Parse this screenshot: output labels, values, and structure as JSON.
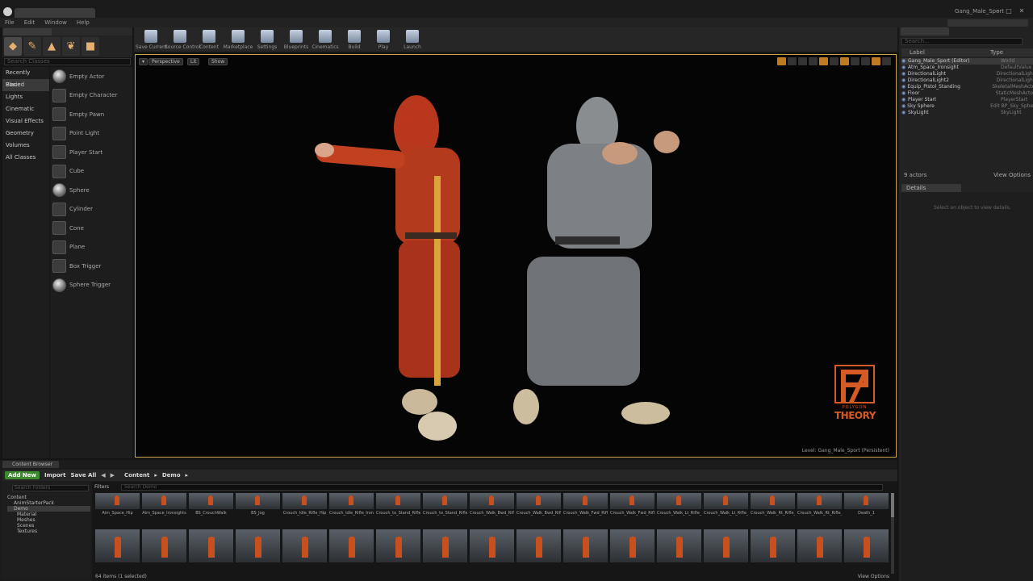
{
  "title_bar": {
    "project_name": "Gang_Male_Sport"
  },
  "menu": [
    "File",
    "Edit",
    "Window",
    "Help"
  ],
  "modes": {
    "search_placeholder": "Search Classes",
    "categories": [
      "Recently Placed",
      "Basic",
      "Lights",
      "Cinematic",
      "Visual Effects",
      "Geometry",
      "Volumes",
      "All Classes"
    ],
    "selected_category": "Basic",
    "actors": [
      "Empty Actor",
      "Empty Character",
      "Empty Pawn",
      "Point Light",
      "Player Start",
      "Cube",
      "Sphere",
      "Cylinder",
      "Cone",
      "Plane",
      "Box Trigger",
      "Sphere Trigger"
    ]
  },
  "toolbar": [
    "Save Current",
    "Source Control",
    "Content",
    "Marketplace",
    "Settings",
    "Blueprints",
    "Cinematics",
    "Build",
    "Play",
    "Launch"
  ],
  "viewport": {
    "perspective": "Perspective",
    "lit": "Lit",
    "show": "Show",
    "level": "Level:  Gang_Male_Sport (Persistent)",
    "logo_top": "POLYGON",
    "logo_name": "THEORY"
  },
  "world_outliner": {
    "search_placeholder": "Search...",
    "col_label": "Label",
    "col_type": "Type",
    "rows": [
      {
        "label": "Gang_Male_Sport (Editor)",
        "type": "World"
      },
      {
        "label": "Atm_Space_Ironsight",
        "type": "DefaultValue"
      },
      {
        "label": "DirectionalLight",
        "type": "DirectionalLight"
      },
      {
        "label": "DirectionalLight2",
        "type": "DirectionalLight"
      },
      {
        "label": "Equip_Pistol_Standing",
        "type": "SkeletalMeshActor"
      },
      {
        "label": "Floor",
        "type": "StaticMeshActor"
      },
      {
        "label": "Player Start",
        "type": "PlayerStart"
      },
      {
        "label": "Sky Sphere",
        "type": "Edit BP_Sky_Sphere"
      },
      {
        "label": "SkyLight",
        "type": "SkyLight"
      }
    ],
    "count": "9 actors",
    "view_options": "View Options"
  },
  "details": {
    "tab": "Details",
    "hint": "Select an object to view details."
  },
  "content_browser": {
    "tab": "Content Browser",
    "add_new": "Add New",
    "import": "Import",
    "save_all": "Save All",
    "breadcrumb": [
      "Content",
      "Demo"
    ],
    "filters": "Filters",
    "search_placeholder": "Search Demo",
    "folder_search_placeholder": "Search Folders",
    "folders": [
      "Content",
      "AnimStarterPack",
      "Demo",
      "Material",
      "Meshes",
      "Scenes",
      "Textures"
    ],
    "row1_labels": [
      "Aim_Space_Hip",
      "Aim_Space_Ironsights",
      "BS_CrouchWalk",
      "BS_Jog",
      "Crouch_Idle_Rifle_Hip",
      "Crouch_Idle_Rifle_Ironsights",
      "Crouch_to_Stand_Rifle_Hip",
      "Crouch_to_Stand_Rifle_Ironsights",
      "Crouch_Walk_Bwd_Rifle_Hip",
      "Crouch_Walk_Bwd_Rifle_Ironsights",
      "Crouch_Walk_Fwd_Rifle_Hip",
      "Crouch_Walk_Fwd_Rifle_Ironsights",
      "Crouch_Walk_Lt_Rifle_Hip",
      "Crouch_Walk_Lt_Rifle_Ironsights",
      "Crouch_Walk_Rt_Rifle_Hip",
      "Crouch_Walk_Rt_Rifle_Ironsights",
      "Death_1"
    ],
    "item_count": "64 items (1 selected)",
    "view_options": "View Options"
  }
}
